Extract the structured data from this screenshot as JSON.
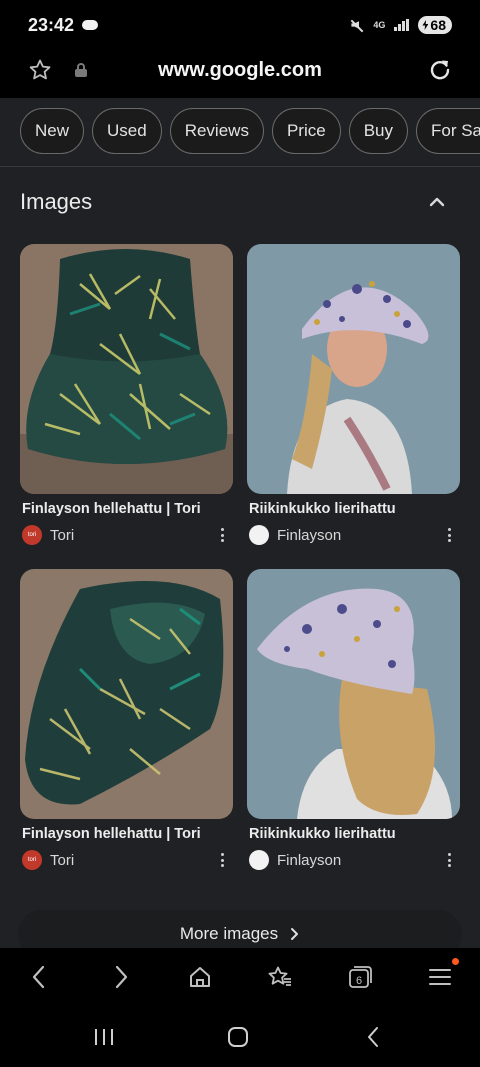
{
  "status": {
    "time": "23:42",
    "network": "4G",
    "battery": "68"
  },
  "browser": {
    "url": "www.google.com",
    "tab_count": "6"
  },
  "filters": [
    "New",
    "Used",
    "Reviews",
    "Price",
    "Buy",
    "For Sale"
  ],
  "images_section": {
    "title": "Images",
    "results": [
      {
        "title": "Finlayson hellehattu | Tori",
        "source": "Tori"
      },
      {
        "title": "Riikinkukko lierihattu",
        "source": "Finlayson"
      },
      {
        "title": "Finlayson hellehattu | Tori",
        "source": "Tori"
      },
      {
        "title": "Riikinkukko lierihattu",
        "source": "Finlayson"
      }
    ],
    "more_label": "More images"
  },
  "colors": {
    "background": "#202124",
    "chip_border": "#6a6a6a",
    "notification": "#ff5a1f"
  },
  "icons": [
    "star-icon",
    "lock-icon",
    "reload-icon",
    "chevron-up-icon",
    "more-vert-icon",
    "chevron-right-icon",
    "back-icon",
    "forward-icon",
    "home-icon",
    "bookmarks-icon",
    "tabs-icon",
    "menu-icon"
  ]
}
